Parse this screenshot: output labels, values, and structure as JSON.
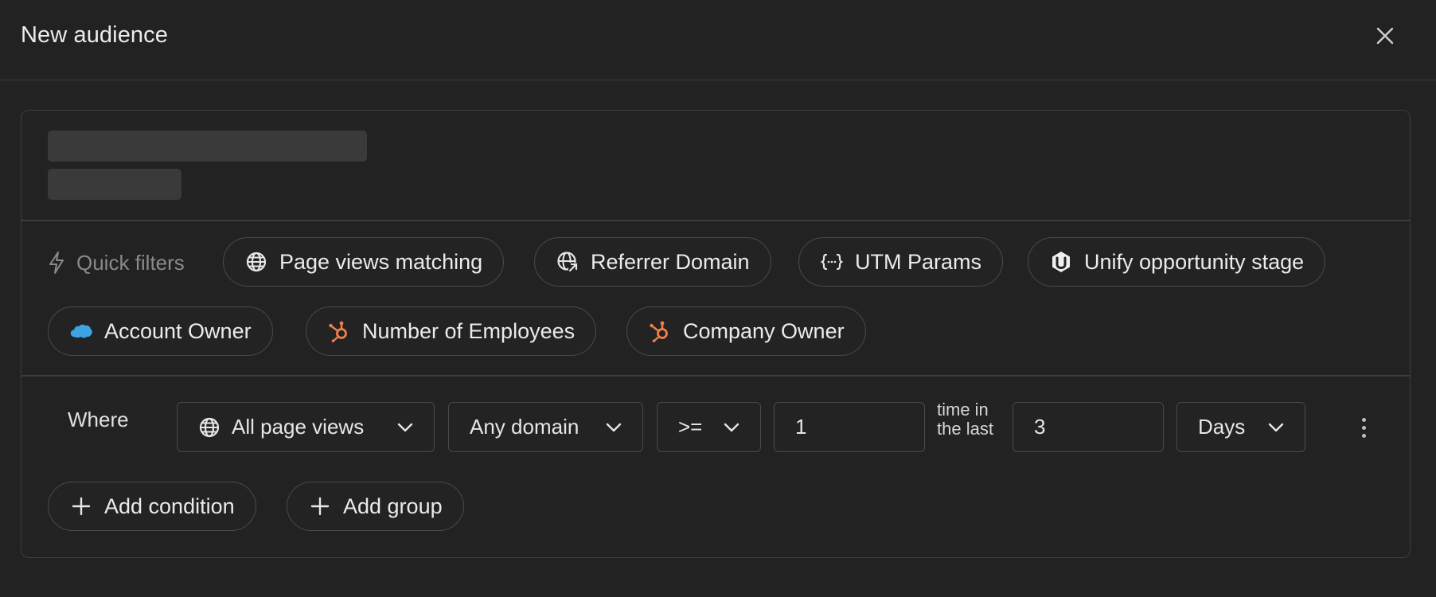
{
  "dialog": {
    "title": "New audience"
  },
  "quick_filters": {
    "label": "Quick filters",
    "chips": [
      {
        "label": "Page views matching",
        "icon": "globe-icon"
      },
      {
        "label": "Referrer Domain",
        "icon": "globe-link-icon"
      },
      {
        "label": "UTM Params",
        "icon": "braces-icon"
      },
      {
        "label": "Unify opportunity stage",
        "icon": "unify-logo-icon"
      },
      {
        "label": "Account Owner",
        "icon": "salesforce-cloud-icon"
      },
      {
        "label": "Number of Employees",
        "icon": "hubspot-icon"
      },
      {
        "label": "Company Owner",
        "icon": "hubspot-icon"
      }
    ]
  },
  "condition": {
    "where_label": "Where",
    "event_select": "All page views",
    "domain_select": "Any domain",
    "operator_select": ">=",
    "count_value": "1",
    "time_label": "time in the last",
    "period_value": "3",
    "unit_select": "Days"
  },
  "actions": {
    "add_condition": "Add condition",
    "add_group": "Add group"
  },
  "colors": {
    "background": "#222222",
    "border": "#4a4a4a",
    "salesforce": "#3da4e6",
    "hubspot": "#f07e4e"
  }
}
